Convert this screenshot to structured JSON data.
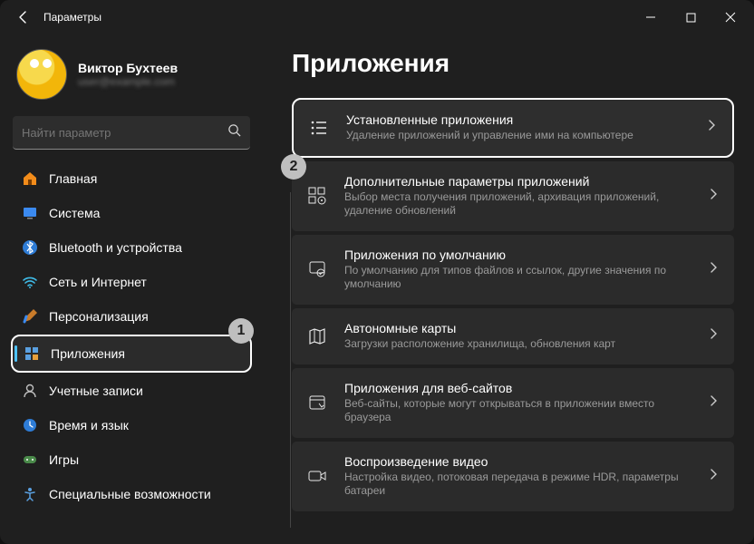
{
  "window": {
    "title": "Параметры"
  },
  "profile": {
    "name": "Виктор Бухтеев",
    "email": "user@example.com"
  },
  "search": {
    "placeholder": "Найти параметр"
  },
  "sidebar": {
    "items": [
      {
        "label": "Главная",
        "icon": "home"
      },
      {
        "label": "Система",
        "icon": "system"
      },
      {
        "label": "Bluetooth и устройства",
        "icon": "bluetooth"
      },
      {
        "label": "Сеть и Интернет",
        "icon": "wifi"
      },
      {
        "label": "Персонализация",
        "icon": "personalize"
      },
      {
        "label": "Приложения",
        "icon": "apps",
        "selected": true
      },
      {
        "label": "Учетные записи",
        "icon": "accounts"
      },
      {
        "label": "Время и язык",
        "icon": "time"
      },
      {
        "label": "Игры",
        "icon": "gaming"
      },
      {
        "label": "Специальные возможности",
        "icon": "accessibility"
      }
    ]
  },
  "page": {
    "title": "Приложения",
    "cards": [
      {
        "icon": "list",
        "title": "Установленные приложения",
        "sub": "Удаление приложений и управление ими на компьютере",
        "highlight": true
      },
      {
        "icon": "apps-plus",
        "title": "Дополнительные параметры приложений",
        "sub": "Выбор места получения приложений, архивация приложений, удаление обновлений"
      },
      {
        "icon": "default-apps",
        "title": "Приложения по умолчанию",
        "sub": "По умолчанию для типов файлов и ссылок, другие значения по умолчанию"
      },
      {
        "icon": "maps",
        "title": "Автономные карты",
        "sub": "Загрузки расположение хранилища, обновления карт"
      },
      {
        "icon": "websites",
        "title": "Приложения для веб-сайтов",
        "sub": "Веб-сайты, которые могут открываться в приложении вместо браузера"
      },
      {
        "icon": "video",
        "title": "Воспроизведение видео",
        "sub": "Настройка видео, потоковая передача в режиме HDR, параметры батареи"
      }
    ]
  },
  "steps": {
    "one": "1",
    "two": "2"
  }
}
